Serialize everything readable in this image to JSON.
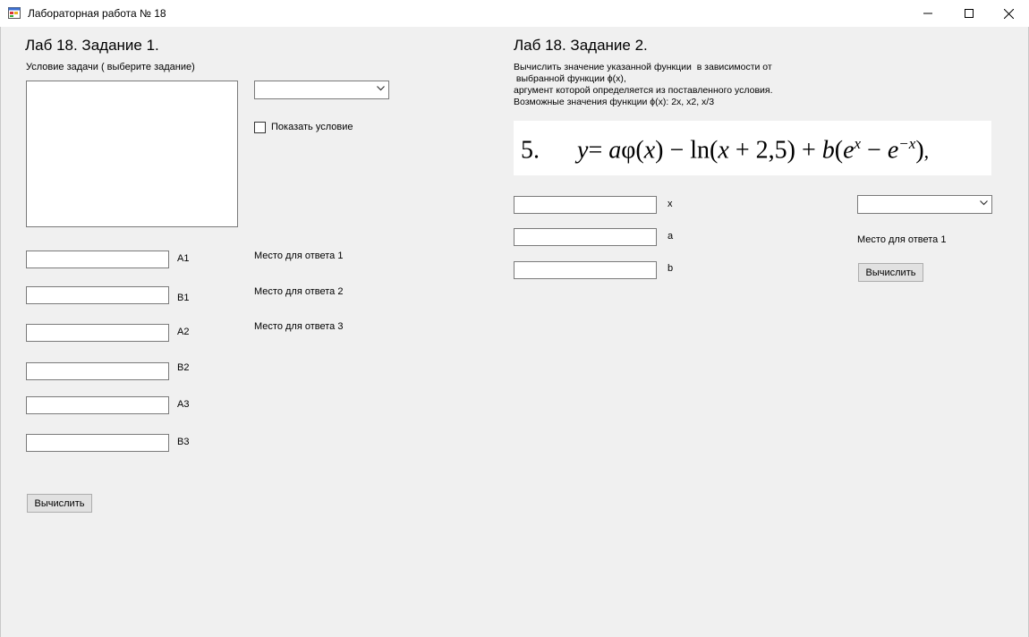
{
  "window": {
    "title": "Лабораторная работа № 18",
    "controls": [
      "minimize",
      "maximize",
      "close"
    ]
  },
  "task1": {
    "heading": "Лаб 18. Задание 1.",
    "condition_label": "Условие задачи ( выберите задание)",
    "condition_text": "",
    "task_select": {
      "selected": ""
    },
    "show_condition_label": "Показать условие",
    "show_condition_checked": false,
    "fields": [
      {
        "label": "A1",
        "value": ""
      },
      {
        "label": "B1",
        "value": ""
      },
      {
        "label": "A2",
        "value": ""
      },
      {
        "label": "B2",
        "value": ""
      },
      {
        "label": "A3",
        "value": ""
      },
      {
        "label": "B3",
        "value": ""
      }
    ],
    "answers": [
      "Место для ответа 1",
      "Место для ответа 2",
      "Место для ответа 3"
    ],
    "compute_label": "Вычислить"
  },
  "task2": {
    "heading": "Лаб 18. Задание 2.",
    "description": "Вычислить значение указанной функции  в зависимости от\n выбранной функции ϕ(x),\nаргумент которой определяется из поставленного условия.\nВозможные значения функции ϕ(x): 2x, x2, x/3",
    "formula": {
      "number": "5.",
      "y": "y",
      "eq": "= ",
      "a": "a",
      "phi": "φ(",
      "x1": "x",
      "close1": ")",
      "minus1": " − ",
      "ln": "ln(",
      "x2": "x",
      "plus": " + 2,5) + ",
      "b": "b",
      "open2": "(",
      "e1": "e",
      "sup1": "x",
      "minus2": " − ",
      "e2": "e",
      "sup2": "−x",
      "close2": ")",
      "comma": ","
    },
    "fields": [
      {
        "label": "x",
        "value": ""
      },
      {
        "label": "a",
        "value": ""
      },
      {
        "label": "b",
        "value": ""
      }
    ],
    "function_select": {
      "selected": ""
    },
    "answer": "Место для ответа 1",
    "compute_label": "Вычислить"
  }
}
